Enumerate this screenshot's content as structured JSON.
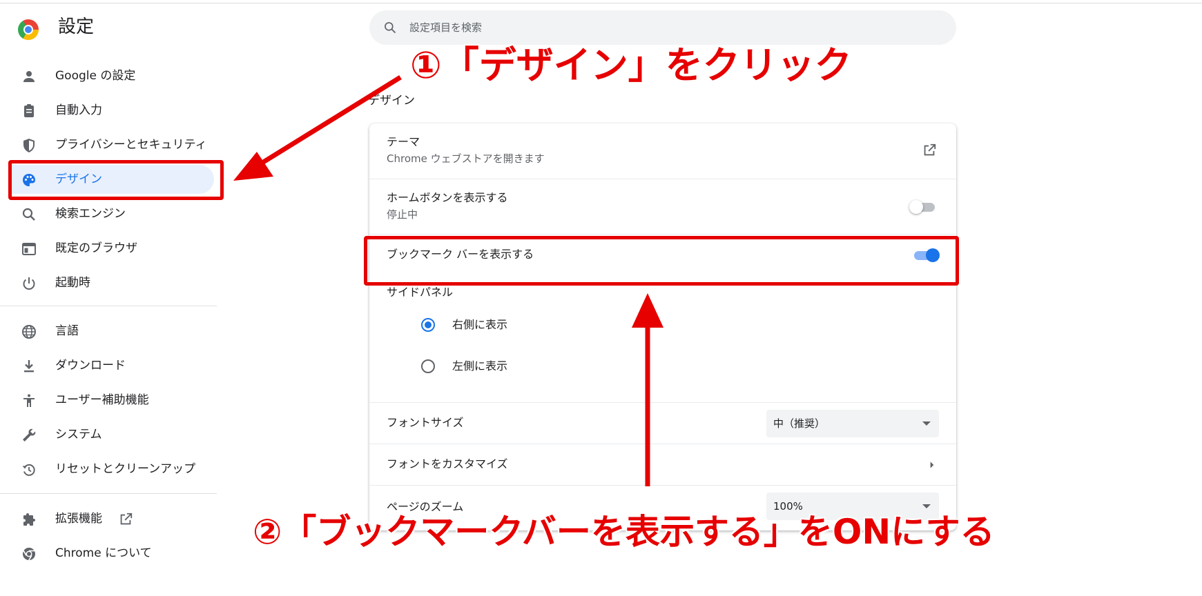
{
  "header": {
    "title": "設定"
  },
  "search": {
    "placeholder": "設定項目を検索"
  },
  "sidebar": {
    "items": [
      {
        "label": "Google の設定"
      },
      {
        "label": "自動入力"
      },
      {
        "label": "プライバシーとセキュリティ"
      },
      {
        "label": "デザイン",
        "active": true
      },
      {
        "label": "検索エンジン"
      },
      {
        "label": "既定のブラウザ"
      },
      {
        "label": "起動時"
      },
      {
        "label": "言語"
      },
      {
        "label": "ダウンロード"
      },
      {
        "label": "ユーザー補助機能"
      },
      {
        "label": "システム"
      },
      {
        "label": "リセットとクリーンアップ"
      },
      {
        "label": "拡張機能"
      },
      {
        "label": "Chrome について"
      }
    ]
  },
  "main": {
    "section_title": "デザイン",
    "theme": {
      "label": "テーマ",
      "sub": "Chrome ウェブストアを開きます"
    },
    "home_button": {
      "label": "ホームボタンを表示する",
      "sub": "停止中",
      "enabled": false
    },
    "bookmarks_bar": {
      "label": "ブックマーク バーを表示する",
      "enabled": true
    },
    "side_panel": {
      "label": "サイドパネル",
      "options": [
        {
          "label": "右側に表示",
          "checked": true
        },
        {
          "label": "左側に表示",
          "checked": false
        }
      ]
    },
    "font_size": {
      "label": "フォントサイズ",
      "value": "中（推奨）"
    },
    "customize_fonts": {
      "label": "フォントをカスタマイズ"
    },
    "page_zoom": {
      "label": "ページのズーム",
      "value": "100%"
    }
  },
  "annotations": {
    "step1": "①「デザイン」をクリック",
    "step2": "②「ブックマークバーを表示する」をONにする",
    "color": "#e60000"
  },
  "colors": {
    "accent": "#1a73e8",
    "active_bg": "#e8f0fe",
    "search_bg": "#f1f3f4"
  }
}
